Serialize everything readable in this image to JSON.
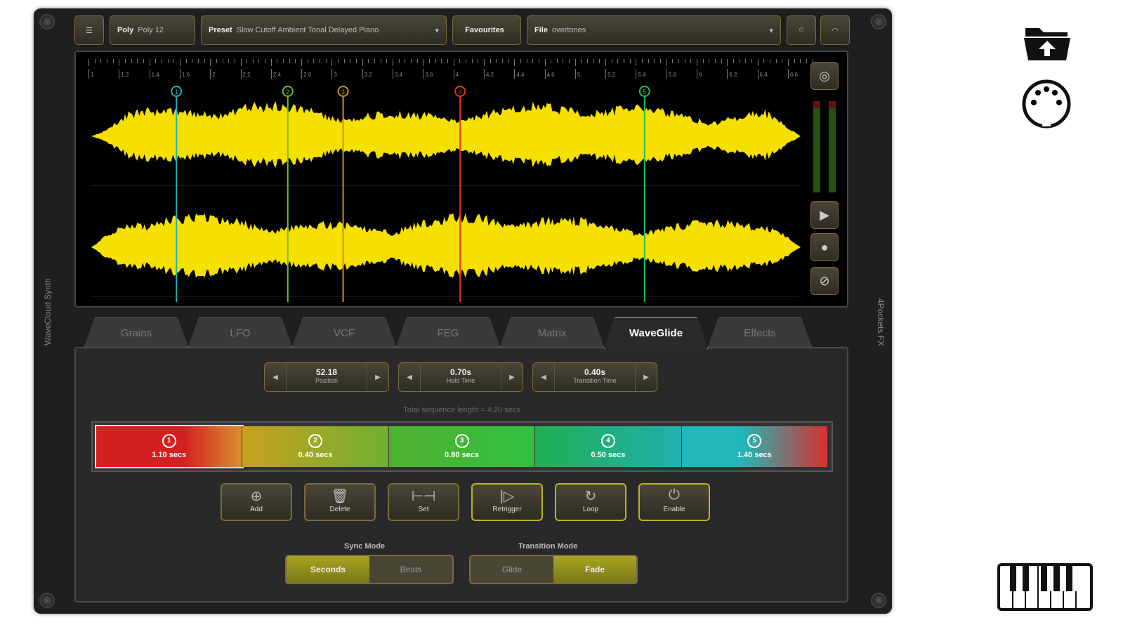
{
  "side_left": "WaveCloud Synth",
  "side_right": "4Pockets FX",
  "toolbar": {
    "poly_label": "Poly",
    "poly_value": "Poly 12",
    "preset_label": "Preset",
    "preset_value": "Slow Cutoff Ambient Tonal Delayed Piano",
    "favourites": "Favourites",
    "file_label": "File",
    "file_value": "overtones"
  },
  "ruler": [
    "1",
    "1.2",
    "1.4",
    "1.6",
    "2",
    "2.2",
    "2.4",
    "2.6",
    "3",
    "3.2",
    "3.4",
    "3.6",
    "4",
    "4.2",
    "4.4",
    "4.6",
    "5",
    "5.2",
    "5.4",
    "5.6",
    "6",
    "6.2",
    "6.4",
    "6.6"
  ],
  "markers": [
    {
      "n": "1",
      "color": "#20b0b0",
      "pos": 0.12
    },
    {
      "n": "2",
      "color": "#6cc020",
      "pos": 0.277
    },
    {
      "n": "3",
      "color": "#c89020",
      "pos": 0.355
    },
    {
      "n": "4",
      "color": "#e03a10",
      "pos": 0.52
    },
    {
      "n": "5",
      "color": "#20c050",
      "pos": 0.78
    }
  ],
  "tabs": [
    "Grains",
    "LFO",
    "VCF",
    "FEG",
    "Matrix",
    "WaveGlide",
    "Effects"
  ],
  "active_tab": "WaveGlide",
  "steppers": [
    {
      "value": "52.18",
      "label": "Position"
    },
    {
      "value": "0.70s",
      "label": "Hold Time"
    },
    {
      "value": "0.40s",
      "label": "Transition Time"
    }
  ],
  "total": "Total sequence length = 4.20 secs",
  "segments": [
    {
      "n": "1",
      "label": "1.10 secs"
    },
    {
      "n": "2",
      "label": "0.40 secs"
    },
    {
      "n": "3",
      "label": "0.80 secs"
    },
    {
      "n": "4",
      "label": "0.50 secs"
    },
    {
      "n": "5",
      "label": "1.40 secs"
    }
  ],
  "actions": [
    {
      "label": "Add",
      "icon": "⊕",
      "name": "add"
    },
    {
      "label": "Delete",
      "icon": "🗑",
      "name": "delete"
    },
    {
      "label": "Set",
      "icon": "⊢⊣",
      "name": "set"
    },
    {
      "label": "Retrigger",
      "icon": "|▷",
      "name": "retrigger"
    },
    {
      "label": "Loop",
      "icon": "↻",
      "name": "loop"
    },
    {
      "label": "Enable",
      "icon": "⏻",
      "name": "enable"
    }
  ],
  "sync_mode": {
    "title": "Sync Mode",
    "options": [
      "Seconds",
      "Beats"
    ],
    "selected": "Seconds"
  },
  "transition_mode": {
    "title": "Transition Mode",
    "options": [
      "Glide",
      "Fade"
    ],
    "selected": "Fade"
  },
  "colors": {
    "wave": "#f5e000",
    "accent": "#a8a420"
  }
}
